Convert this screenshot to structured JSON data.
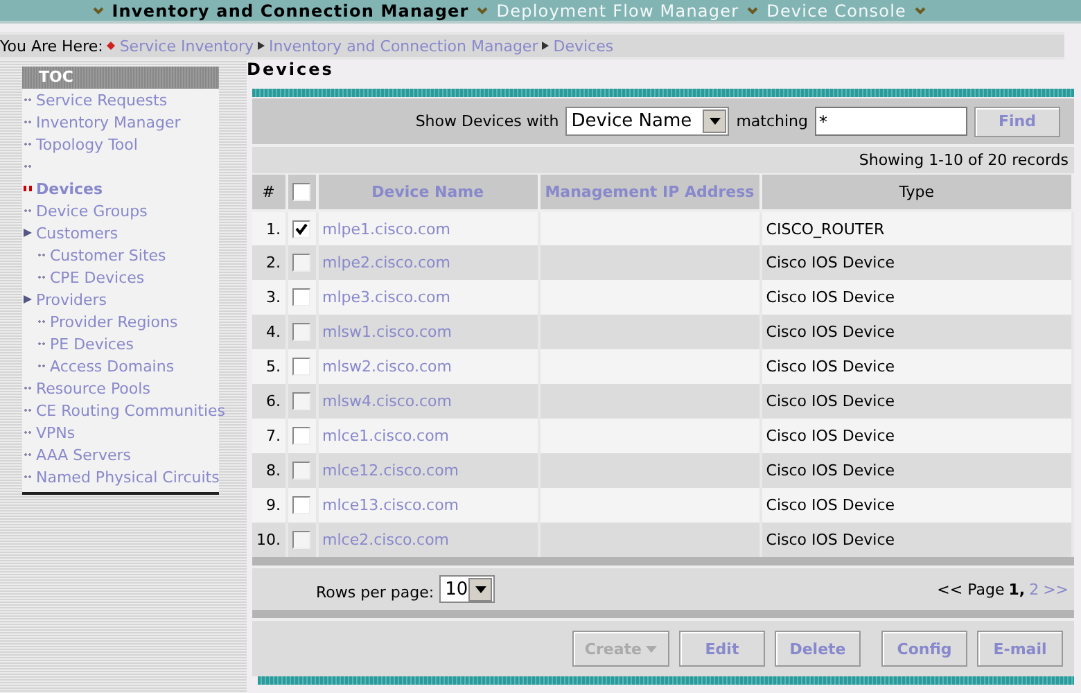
{
  "top_nav": [
    {
      "label": "Inventory and Connection Manager",
      "selected": true
    },
    {
      "label": "Deployment Flow Manager",
      "selected": false
    },
    {
      "label": "Device Console",
      "selected": false
    }
  ],
  "breadcrumb": {
    "prefix": "You Are Here:",
    "items": [
      "Service Inventory",
      "Inventory and Connection Manager",
      "Devices"
    ]
  },
  "toc": {
    "title": "TOC",
    "items": [
      {
        "label": "Service Requests",
        "selected": false
      },
      {
        "label": "Inventory Manager",
        "selected": false
      },
      {
        "label": "Topology Tool",
        "selected": false
      },
      {
        "selected": false
      },
      {
        "label": "Devices",
        "selected": true
      },
      {
        "label": "Device Groups",
        "selected": false
      },
      {
        "label": "Customers",
        "selected": false,
        "children": [
          {
            "label": "Customer Sites",
            "selected": false
          },
          {
            "label": "CPE Devices",
            "selected": false
          }
        ]
      },
      {
        "label": "Providers",
        "selected": false,
        "children": [
          {
            "label": "Provider Regions",
            "selected": false
          },
          {
            "label": "PE Devices",
            "selected": false
          },
          {
            "label": "Access Domains",
            "selected": false
          }
        ]
      },
      {
        "label": "Resource Pools",
        "selected": false
      },
      {
        "label": "CE Routing Communities",
        "selected": false
      },
      {
        "label": "VPNs",
        "selected": false
      },
      {
        "label": "AAA Servers",
        "selected": false
      },
      {
        "label": "Named Physical Circuits",
        "selected": false
      }
    ]
  },
  "page_title": "Devices",
  "filter": {
    "label": "Show Devices with",
    "field": "Device Name",
    "matching_label": "matching",
    "value": "*",
    "button": "Find"
  },
  "record_count": "Showing 1-10 of 20 records",
  "table": {
    "columns": [
      {
        "label": "#",
        "link": false
      },
      {
        "kind": "checkbox",
        "checked": false
      },
      {
        "label": "Device Name",
        "link": true
      },
      {
        "label": "Management IP Address",
        "link": true
      },
      {
        "label": "Type",
        "link": false
      }
    ],
    "rows": [
      {
        "index": "1.",
        "checked": true,
        "name": "mlpe1.cisco.com",
        "type": "CISCO_ROUTER"
      },
      {
        "index": "2.",
        "checked": false,
        "name": "mlpe2.cisco.com",
        "type": "Cisco IOS Device"
      },
      {
        "index": "3.",
        "checked": false,
        "name": "mlpe3.cisco.com",
        "type": "Cisco IOS Device"
      },
      {
        "index": "4.",
        "checked": false,
        "name": "mlsw1.cisco.com",
        "type": "Cisco IOS Device"
      },
      {
        "index": "5.",
        "checked": false,
        "name": "mlsw2.cisco.com",
        "type": "Cisco IOS Device"
      },
      {
        "index": "6.",
        "checked": false,
        "name": "mlsw4.cisco.com",
        "type": "Cisco IOS Device"
      },
      {
        "index": "7.",
        "checked": false,
        "name": "mlce1.cisco.com",
        "type": "Cisco IOS Device"
      },
      {
        "index": "8.",
        "checked": false,
        "name": "mlce12.cisco.com",
        "type": "Cisco IOS Device"
      },
      {
        "index": "9.",
        "checked": false,
        "name": "mlce13.cisco.com",
        "type": "Cisco IOS Device"
      },
      {
        "index": "10.",
        "checked": false,
        "name": "mlce2.cisco.com",
        "type": "Cisco IOS Device"
      }
    ]
  },
  "rows_per_page": {
    "label": "Rows per page:",
    "value": "10"
  },
  "pagination": {
    "prev": "<<",
    "page_label": "Page",
    "current": "1,",
    "pages": [
      "2"
    ],
    "next": ">>"
  },
  "actions": [
    {
      "label": "Create",
      "disabled": true,
      "menu": true
    },
    {
      "label": "Edit",
      "disabled": false,
      "menu": false
    },
    {
      "label": "Delete",
      "disabled": false,
      "menu": false
    },
    {
      "label": "Config",
      "disabled": false,
      "menu": false
    },
    {
      "label": "E-mail",
      "disabled": false,
      "menu": false
    }
  ]
}
